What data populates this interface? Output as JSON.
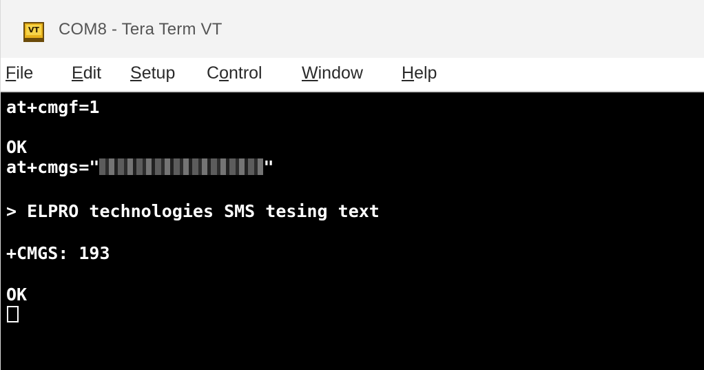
{
  "window": {
    "title": "COM8 - Tera Term VT",
    "icon_label": "VT"
  },
  "menu": {
    "file": {
      "mnemonic": "F",
      "rest": "ile"
    },
    "edit": {
      "mnemonic": "E",
      "rest": "dit"
    },
    "setup": {
      "mnemonic": "S",
      "rest": "etup"
    },
    "control": {
      "pre": "C",
      "mnemonic": "o",
      "rest": "ntrol"
    },
    "window": {
      "mnemonic": "W",
      "rest": "indow"
    },
    "help": {
      "mnemonic": "H",
      "rest": "elp"
    }
  },
  "terminal": {
    "lines": [
      "at+cmgf=1",
      "OK",
      "at+cmgs=\"",
      "\"",
      "> ELPRO technologies SMS tesing text",
      "+CMGS: 193",
      "OK"
    ]
  },
  "colors": {
    "terminal_bg": "#000000",
    "terminal_fg": "#ffffff",
    "titlebar_bg": "#f3f3f3"
  }
}
